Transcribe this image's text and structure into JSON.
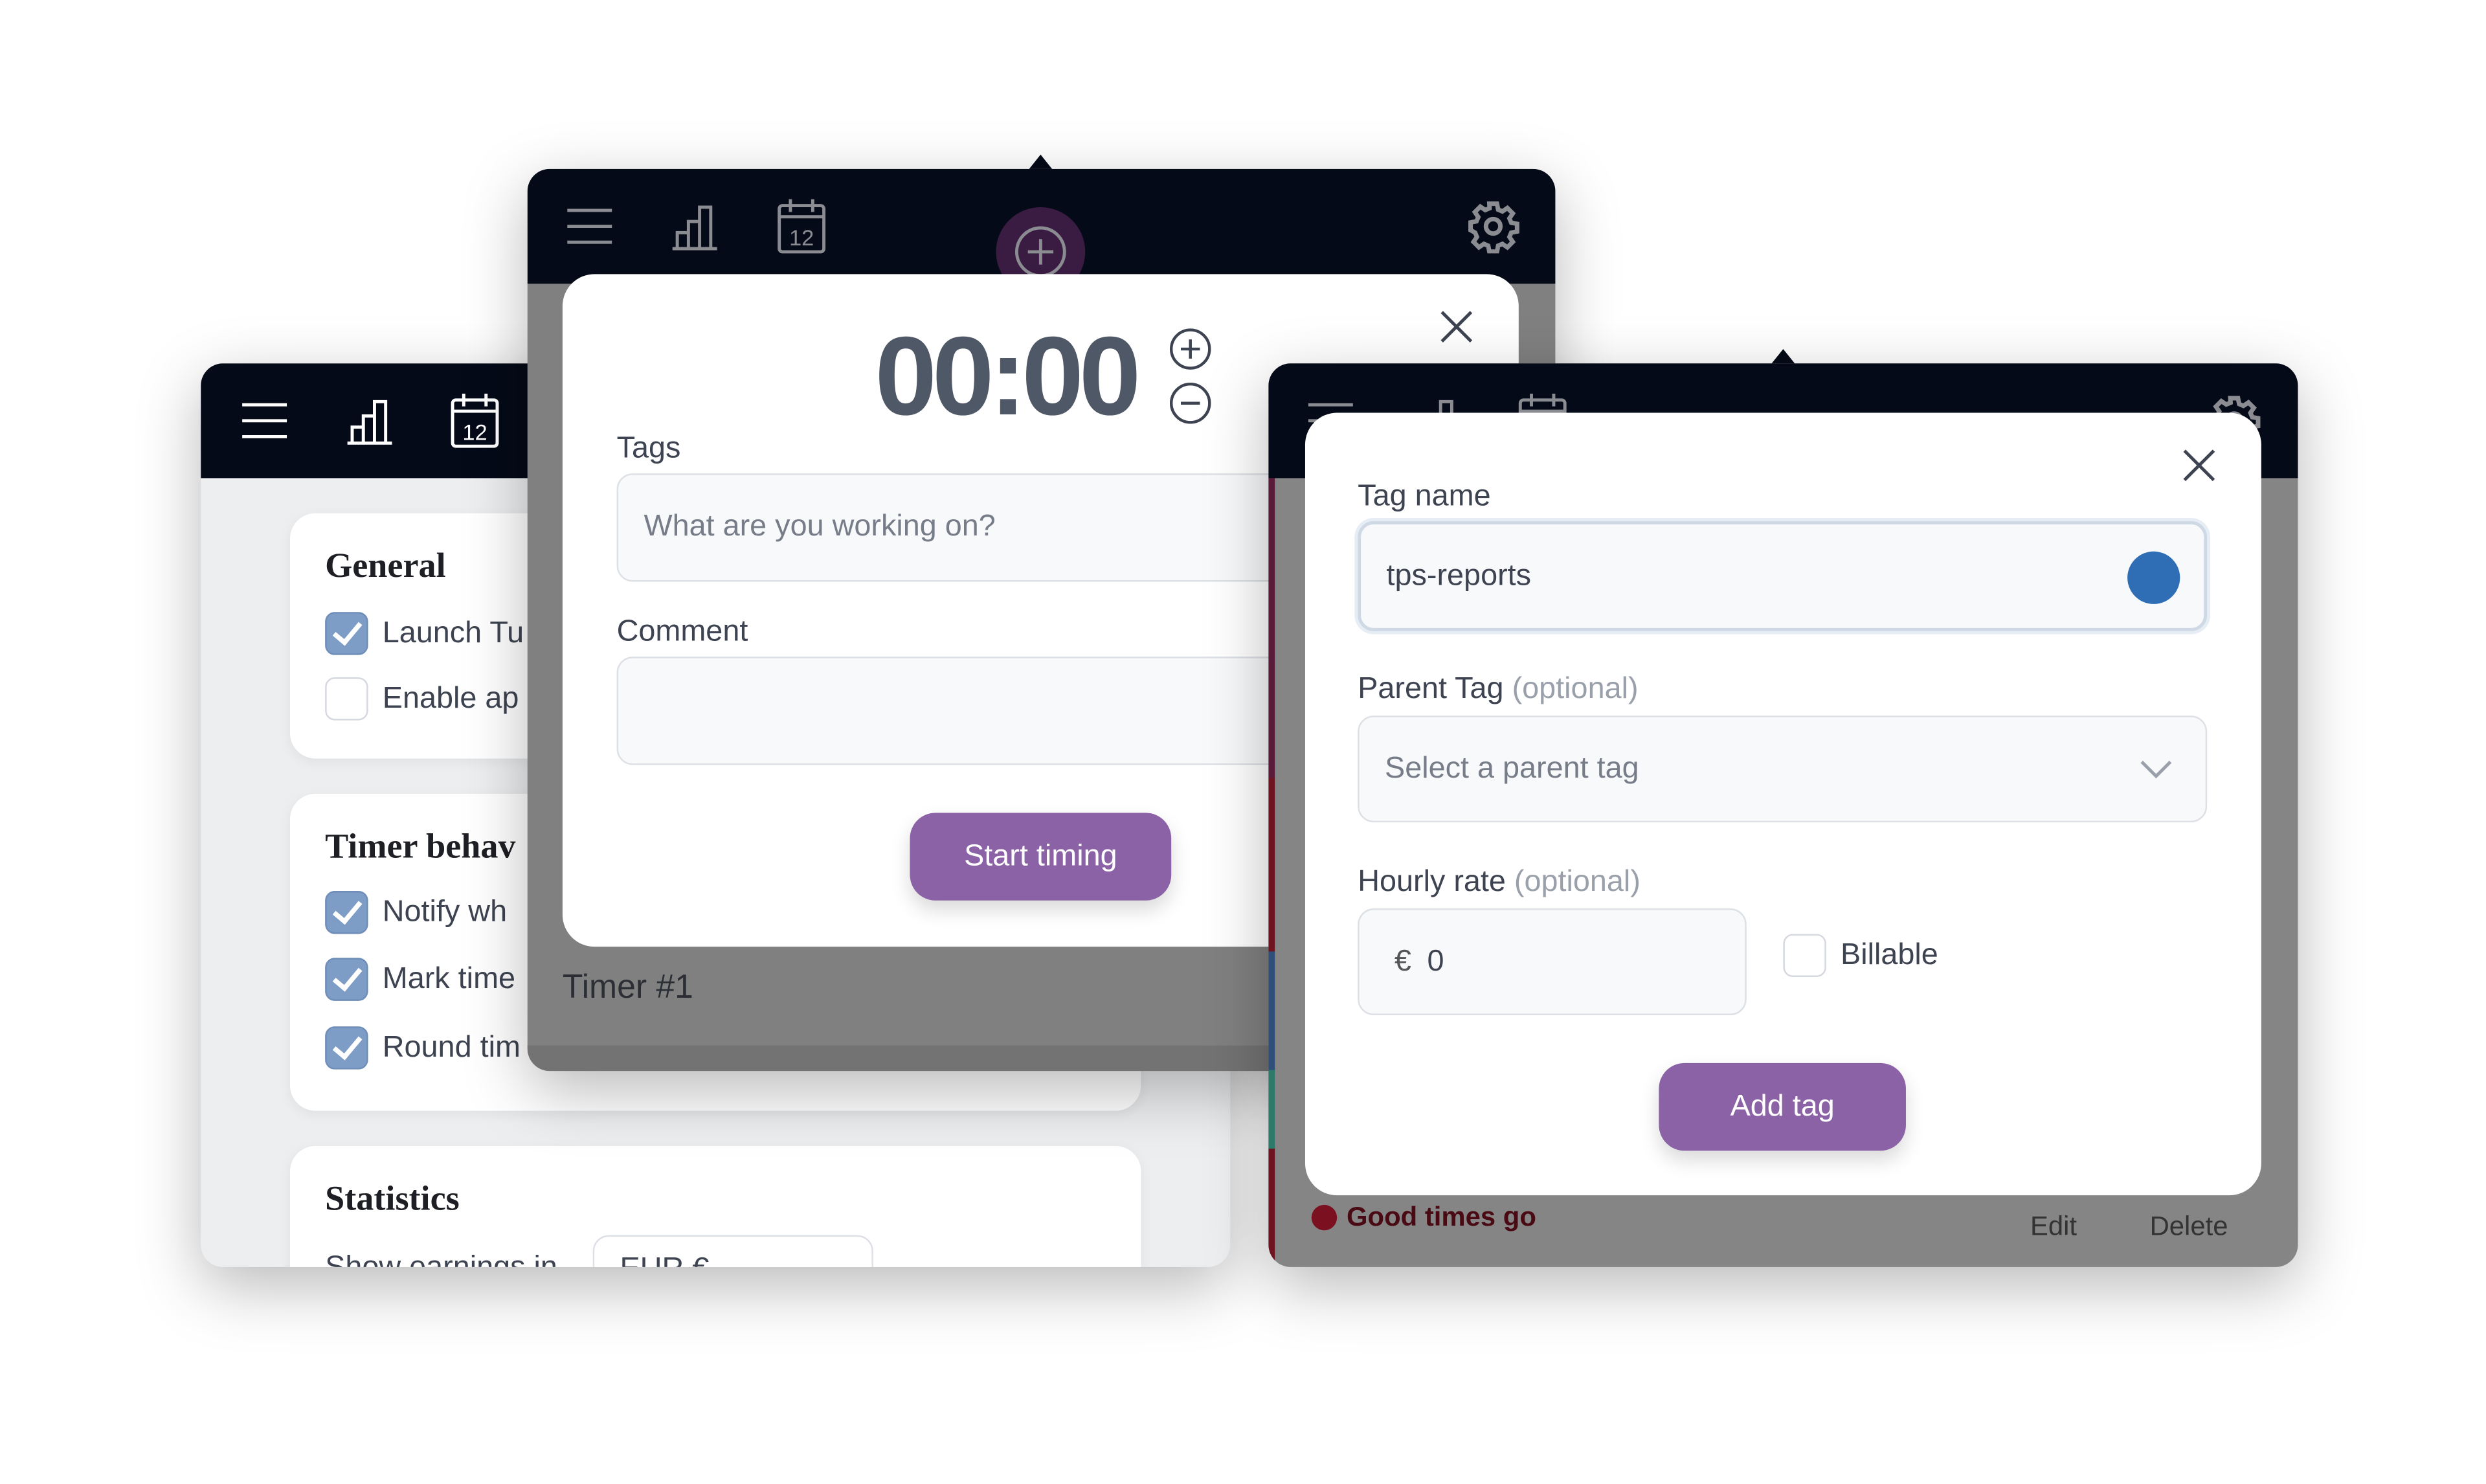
{
  "colors": {
    "accent": "#8b62a5",
    "header": "#050a18",
    "tag_color": "#2f6eb5",
    "good_times": "#7a1020"
  },
  "settings_window": {
    "header_icons": [
      "menu-icon",
      "bar-chart-icon",
      "calendar-icon"
    ],
    "calendar_day": "12",
    "general": {
      "title": "General",
      "items": [
        {
          "label": "Launch Tu",
          "checked": true
        },
        {
          "label": "Enable ap",
          "checked": false
        }
      ]
    },
    "timer_behaviour": {
      "title": "Timer behav",
      "items": [
        {
          "label": "Notify wh",
          "checked": true
        },
        {
          "label": "Mark time",
          "checked": true
        },
        {
          "label": "Round tim",
          "checked": true
        }
      ]
    },
    "statistics": {
      "title": "Statistics",
      "row_label": "Show earnings in",
      "select_value": "EUR €"
    }
  },
  "timer_window": {
    "calendar_day": "12",
    "time": "00:00",
    "tags_label": "Tags",
    "tags_placeholder": "What are you working on?",
    "comment_label": "Comment",
    "start_button": "Start timing",
    "timer_name": "Timer #1"
  },
  "tag_window": {
    "tag_name_label": "Tag name",
    "tag_name_value": "tps-reports",
    "parent_tag_label": "Parent Tag",
    "optional": "(optional)",
    "parent_tag_placeholder": "Select a parent tag",
    "hourly_rate_label": "Hourly rate",
    "currency": "€",
    "hourly_rate_value": "0",
    "billable_label": "Billable",
    "billable_checked": false,
    "add_button": "Add tag",
    "list_item": {
      "name": "Good times go",
      "edit": "Edit",
      "delete": "Delete"
    }
  }
}
